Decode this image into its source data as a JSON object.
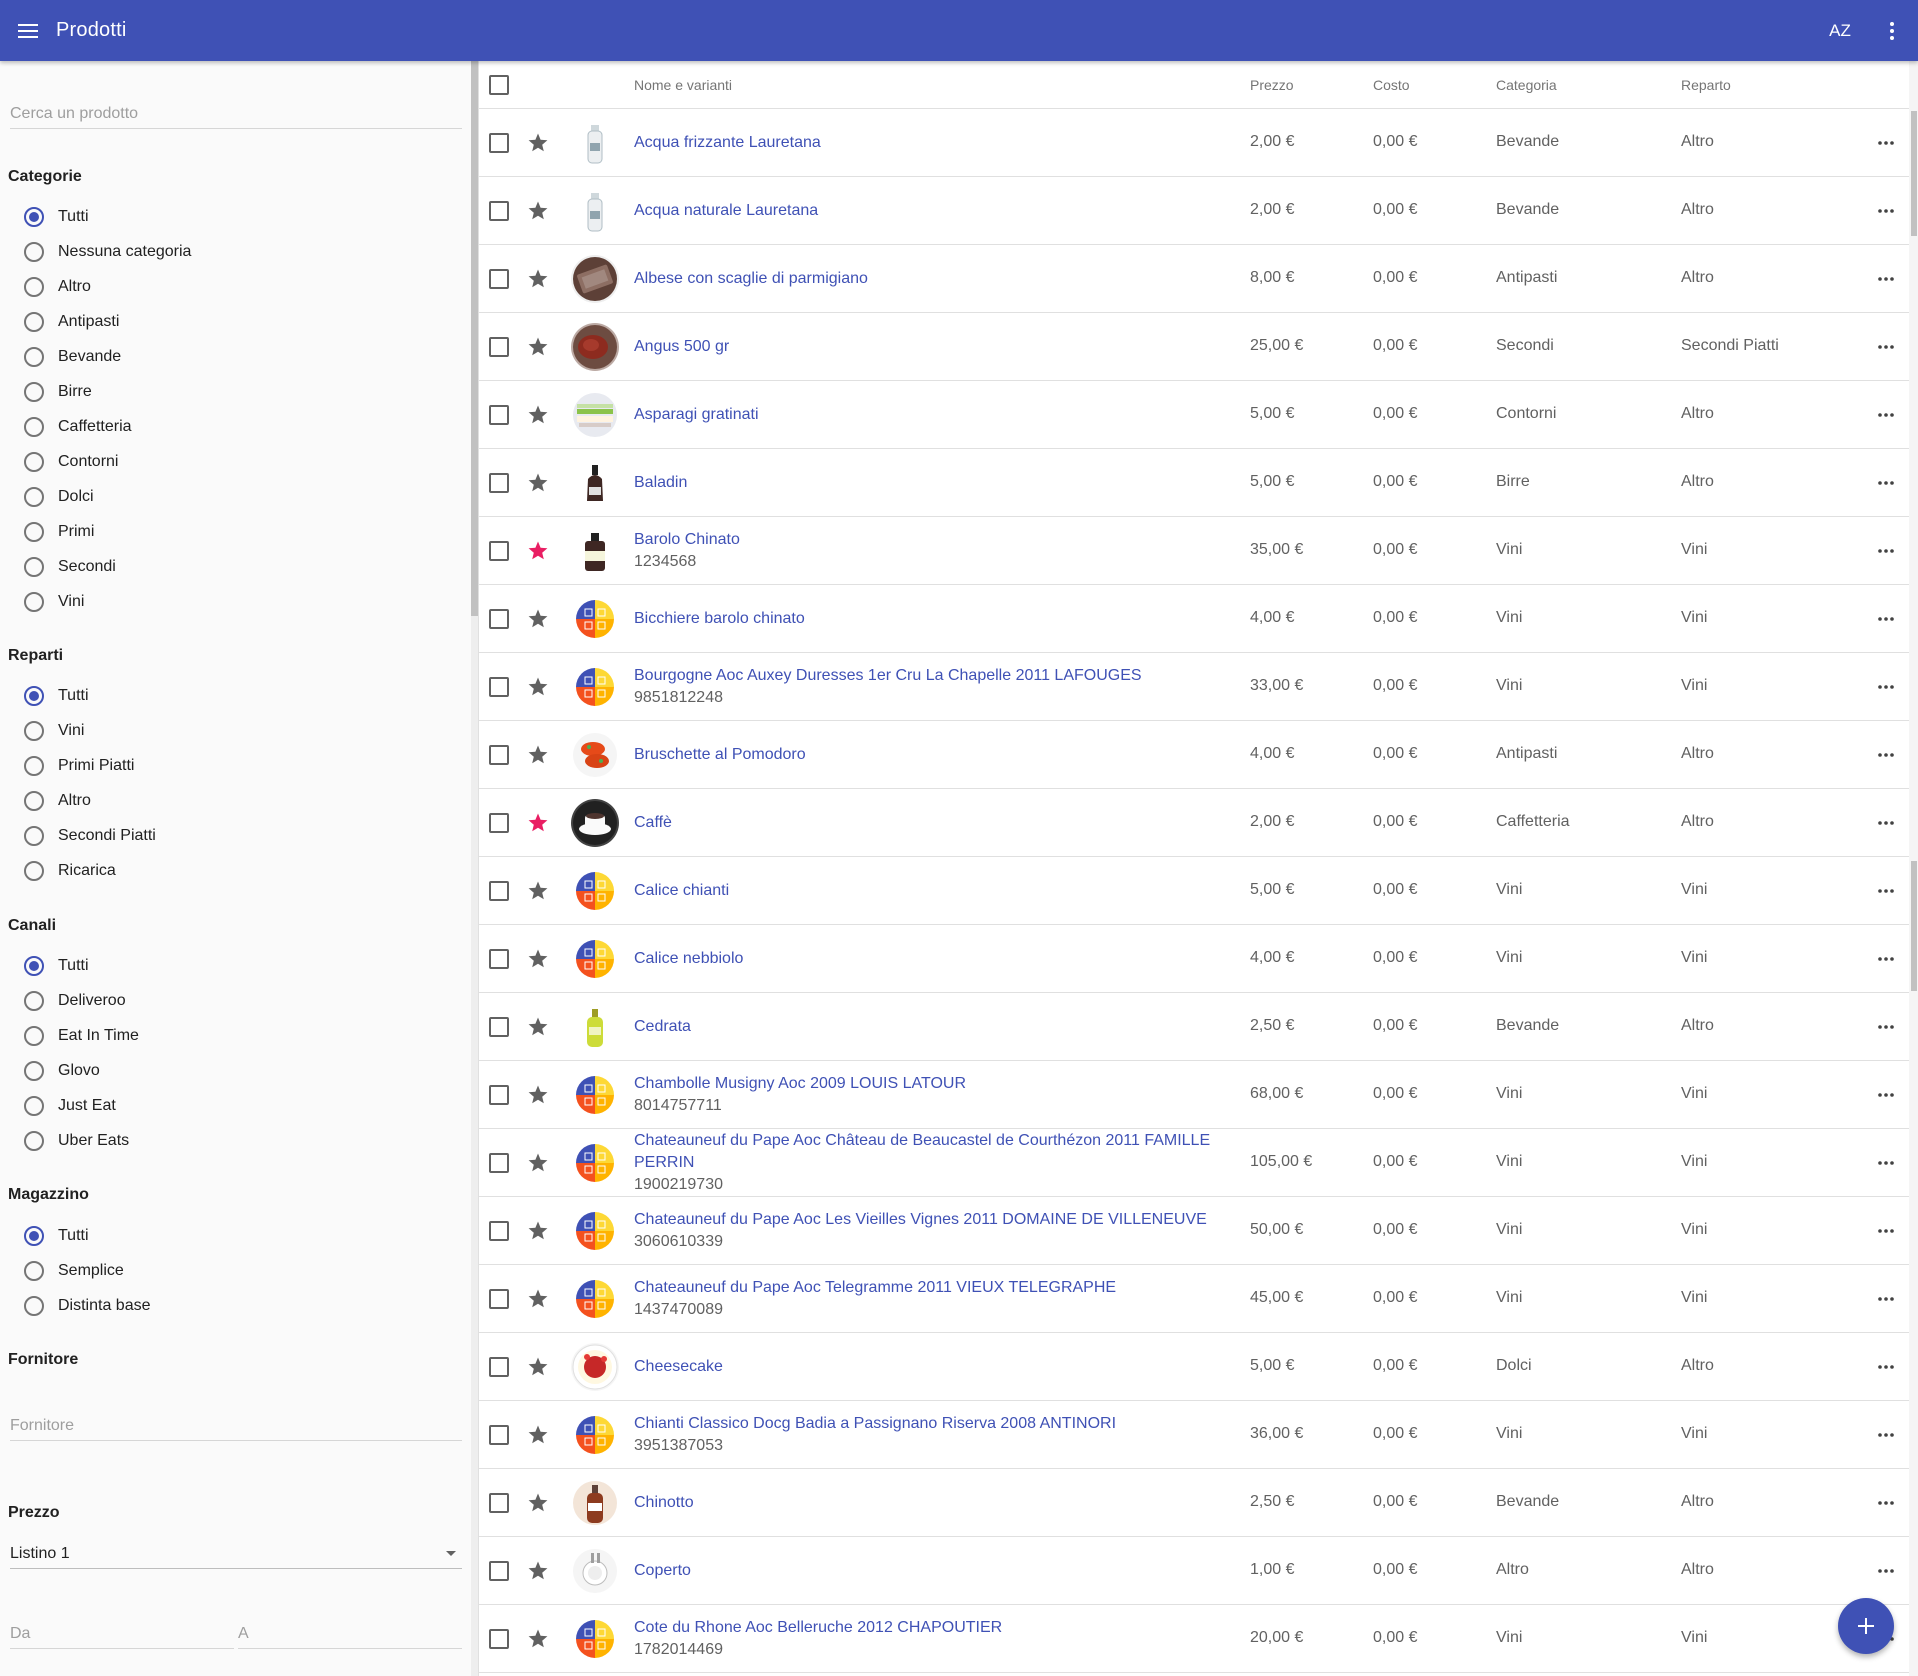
{
  "topbar": {
    "title": "Prodotti",
    "sort_label": "AZ",
    "colors": {
      "primary": "#3f51b5",
      "accent": "#e91e63"
    }
  },
  "sidebar": {
    "search_placeholder": "Cerca un prodotto",
    "categories": {
      "title": "Categorie",
      "items": [
        "Tutti",
        "Nessuna categoria",
        "Altro",
        "Antipasti",
        "Bevande",
        "Birre",
        "Caffetteria",
        "Contorni",
        "Dolci",
        "Primi",
        "Secondi",
        "Vini"
      ],
      "selected": "Tutti"
    },
    "departments": {
      "title": "Reparti",
      "items": [
        "Tutti",
        "Vini",
        "Primi Piatti",
        "Altro",
        "Secondi Piatti",
        "Ricarica"
      ],
      "selected": "Tutti"
    },
    "channels": {
      "title": "Canali",
      "items": [
        "Tutti",
        "Deliveroo",
        "Eat In Time",
        "Glovo",
        "Just Eat",
        "Uber Eats"
      ],
      "selected": "Tutti"
    },
    "warehouse": {
      "title": "Magazzino",
      "items": [
        "Tutti",
        "Semplice",
        "Distinta base"
      ],
      "selected": "Tutti"
    },
    "supplier": {
      "title": "Fornitore",
      "placeholder": "Fornitore"
    },
    "price": {
      "title": "Prezzo",
      "list_value": "Listino 1",
      "from_placeholder": "Da",
      "to_placeholder": "A"
    }
  },
  "table": {
    "columns": {
      "name": "Nome e varianti",
      "price": "Prezzo",
      "cost": "Costo",
      "category": "Categoria",
      "department": "Reparto"
    },
    "rows": [
      {
        "name": "Acqua frizzante Lauretana",
        "code": "",
        "price": "2,00 €",
        "cost": "0,00 €",
        "category": "Bevande",
        "department": "Altro",
        "favorite": false,
        "image": "bottle-water"
      },
      {
        "name": "Acqua naturale Lauretana",
        "code": "",
        "price": "2,00 €",
        "cost": "0,00 €",
        "category": "Bevande",
        "department": "Altro",
        "favorite": false,
        "image": "bottle-water"
      },
      {
        "name": "Albese con scaglie di parmigiano",
        "code": "",
        "price": "8,00 €",
        "cost": "0,00 €",
        "category": "Antipasti",
        "department": "Altro",
        "favorite": false,
        "image": "food-plate"
      },
      {
        "name": "Angus 500 gr",
        "code": "",
        "price": "25,00 €",
        "cost": "0,00 €",
        "category": "Secondi",
        "department": "Secondi Piatti",
        "favorite": false,
        "image": "meat"
      },
      {
        "name": "Asparagi gratinati",
        "code": "",
        "price": "5,00 €",
        "cost": "0,00 €",
        "category": "Contorni",
        "department": "Altro",
        "favorite": false,
        "image": "vegetables"
      },
      {
        "name": "Baladin",
        "code": "",
        "price": "5,00 €",
        "cost": "0,00 €",
        "category": "Birre",
        "department": "Altro",
        "favorite": false,
        "image": "beer-bottle"
      },
      {
        "name": "Barolo Chinato",
        "code": "1234568",
        "price": "35,00 €",
        "cost": "0,00 €",
        "category": "Vini",
        "department": "Vini",
        "favorite": true,
        "image": "dark-bottle"
      },
      {
        "name": "Bicchiere barolo chinato",
        "code": "",
        "price": "4,00 €",
        "cost": "0,00 €",
        "category": "Vini",
        "department": "Vini",
        "favorite": false,
        "image": "placeholder-logo"
      },
      {
        "name": "Bourgogne Aoc Auxey Duresses 1er Cru La Chapelle 2011 LAFOUGES",
        "code": "9851812248",
        "price": "33,00 €",
        "cost": "0,00 €",
        "category": "Vini",
        "department": "Vini",
        "favorite": false,
        "image": "placeholder-logo"
      },
      {
        "name": "Bruschette al Pomodoro",
        "code": "",
        "price": "4,00 €",
        "cost": "0,00 €",
        "category": "Antipasti",
        "department": "Altro",
        "favorite": false,
        "image": "bruschetta"
      },
      {
        "name": "Caffè",
        "code": "",
        "price": "2,00 €",
        "cost": "0,00 €",
        "category": "Caffetteria",
        "department": "Altro",
        "favorite": true,
        "image": "coffee"
      },
      {
        "name": "Calice chianti",
        "code": "",
        "price": "5,00 €",
        "cost": "0,00 €",
        "category": "Vini",
        "department": "Vini",
        "favorite": false,
        "image": "placeholder-logo"
      },
      {
        "name": "Calice nebbiolo",
        "code": "",
        "price": "4,00 €",
        "cost": "0,00 €",
        "category": "Vini",
        "department": "Vini",
        "favorite": false,
        "image": "placeholder-logo"
      },
      {
        "name": "Cedrata",
        "code": "",
        "price": "2,50 €",
        "cost": "0,00 €",
        "category": "Bevande",
        "department": "Altro",
        "favorite": false,
        "image": "cedrata-bottle"
      },
      {
        "name": "Chambolle Musigny Aoc 2009 LOUIS LATOUR",
        "code": "8014757711",
        "price": "68,00 €",
        "cost": "0,00 €",
        "category": "Vini",
        "department": "Vini",
        "favorite": false,
        "image": "placeholder-logo"
      },
      {
        "name": "Chateauneuf du Pape Aoc Château de Beaucastel de Courthézon 2011 FAMILLE PERRIN",
        "code": "1900219730",
        "price": "105,00 €",
        "cost": "0,00 €",
        "category": "Vini",
        "department": "Vini",
        "favorite": false,
        "image": "placeholder-logo"
      },
      {
        "name": "Chateauneuf du Pape Aoc Les Vieilles Vignes 2011 DOMAINE DE VILLENEUVE",
        "code": "3060610339",
        "price": "50,00 €",
        "cost": "0,00 €",
        "category": "Vini",
        "department": "Vini",
        "favorite": false,
        "image": "placeholder-logo"
      },
      {
        "name": "Chateauneuf du Pape Aoc Telegramme 2011 VIEUX TELEGRAPHE",
        "code": "1437470089",
        "price": "45,00 €",
        "cost": "0,00 €",
        "category": "Vini",
        "department": "Vini",
        "favorite": false,
        "image": "placeholder-logo"
      },
      {
        "name": "Cheesecake",
        "code": "",
        "price": "5,00 €",
        "cost": "0,00 €",
        "category": "Dolci",
        "department": "Altro",
        "favorite": false,
        "image": "cheesecake"
      },
      {
        "name": "Chianti Classico Docg Badia a Passignano Riserva 2008 ANTINORI",
        "code": "3951387053",
        "price": "36,00 €",
        "cost": "0,00 €",
        "category": "Vini",
        "department": "Vini",
        "favorite": false,
        "image": "placeholder-logo"
      },
      {
        "name": "Chinotto",
        "code": "",
        "price": "2,50 €",
        "cost": "0,00 €",
        "category": "Bevande",
        "department": "Altro",
        "favorite": false,
        "image": "chinotto-bottle"
      },
      {
        "name": "Coperto",
        "code": "",
        "price": "1,00 €",
        "cost": "0,00 €",
        "category": "Altro",
        "department": "Altro",
        "favorite": false,
        "image": "table-setting"
      },
      {
        "name": "Cote du Rhone Aoc Belleruche 2012 CHAPOUTIER",
        "code": "1782014469",
        "price": "20,00 €",
        "cost": "0,00 €",
        "category": "Vini",
        "department": "Vini",
        "favorite": false,
        "image": "placeholder-logo"
      }
    ]
  }
}
